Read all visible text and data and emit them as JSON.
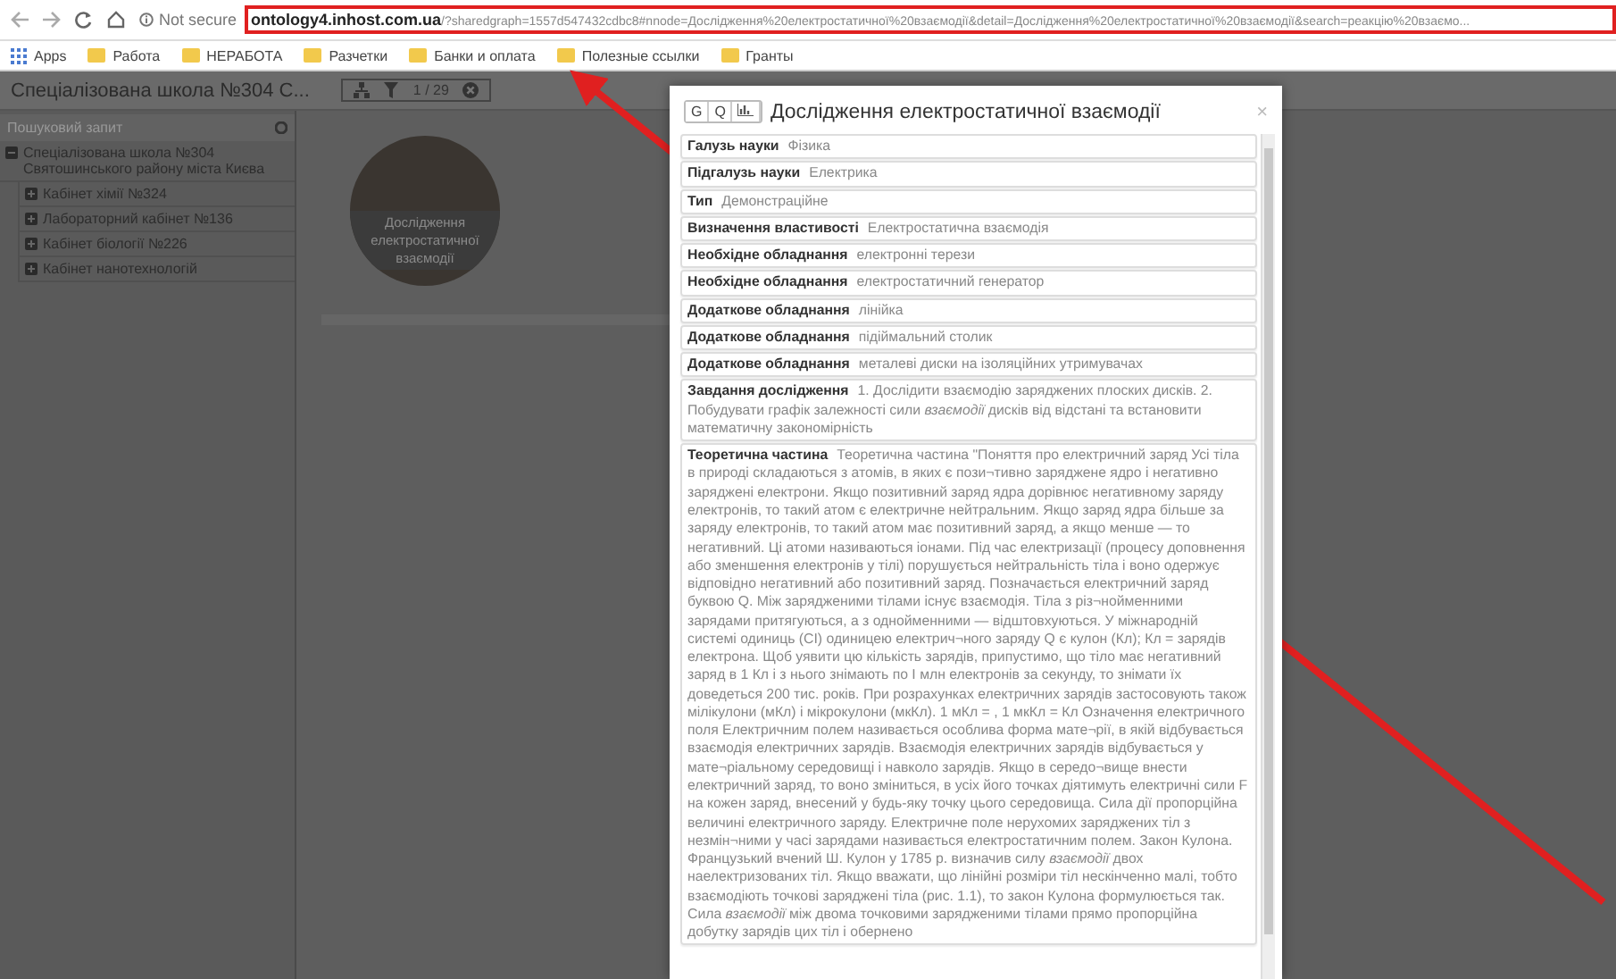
{
  "browser": {
    "security": "Not secure",
    "url_host": "ontology4.inhost.com.ua",
    "url_rest": "/?sharedgraph=1557d547432cdbc8#nnode=Дослідження%20електростатичної%20взаємодії&detail=Дослідження%20електростатичної%20взаємодії&search=реакцію%20взаємо...",
    "bookmarks": [
      {
        "label": "Apps",
        "kind": "apps"
      },
      {
        "label": "Работа",
        "kind": "folder"
      },
      {
        "label": "НЕРАБОТА",
        "kind": "folder"
      },
      {
        "label": "Разчетки",
        "kind": "folder"
      },
      {
        "label": "Банки и оплата",
        "kind": "folder"
      },
      {
        "label": "Полезные ссылки",
        "kind": "folder"
      },
      {
        "label": "Гранты",
        "kind": "folder"
      }
    ]
  },
  "app": {
    "title": "Спеціалізована школа №304 С...",
    "counter": "1 / 29",
    "search": {
      "placeholder": "Пошуковий запит"
    },
    "tree": [
      {
        "label": "Спеціалізована школа №304 Святошинського району міста Києва",
        "expanded": true,
        "children": [
          {
            "label": "Кабінет хімії №324",
            "expanded": false
          },
          {
            "label": "Лабораторний кабінет №136",
            "expanded": false
          },
          {
            "label": "Кабінет біології №226",
            "expanded": false
          },
          {
            "label": "Кабінет нанотехнологій",
            "expanded": false
          }
        ]
      }
    ],
    "node": {
      "label": "Дослідження електростатичної взаємодії"
    }
  },
  "dialog": {
    "buttons": [
      "G",
      "Q"
    ],
    "title": "Дослідження електростатичної взаємодії",
    "close": "×",
    "rows": [
      {
        "label": "Галузь науки",
        "value": "Фізика"
      },
      {
        "label": "Підгалузь науки",
        "value": "Електрика"
      },
      {
        "label": "Тип",
        "value": "Демонстраційне"
      },
      {
        "label": "Визначення властивості",
        "value": "Електростатична взаємодія"
      },
      {
        "label": "Необхідне обладнання",
        "value": "електронні терези"
      },
      {
        "label": "Необхідне обладнання",
        "value": "електростатичний генератор"
      },
      {
        "label": "Додаткове обладнання",
        "value": "лінійка"
      },
      {
        "label": "Додаткове обладнання",
        "value": "підіймальний столик"
      },
      {
        "label": "Додаткове обладнання",
        "value": "металеві диски на ізоляційних утримувачах"
      },
      {
        "label": "Завдання дослідження",
        "value": "1. Дослідити взаємодію заряджених плоских дисків. 2. Побудувати графік залежності сили *взаємодії* дисків від відстані та встановити математичну закономірність"
      },
      {
        "label": "Теоретична частина",
        "value": "Теоретична частина \"Поняття про електричний заряд Усі тіла в природі складаються з атомів, в яких є пози¬тивно заряджене ядро і негативно заряджені електрони. Якщо позитивний заряд ядра дорівнює негативному заряду електронів, то такий атом є електричне нейтральним. Якщо заряд ядра більше за заряду електронів, то такий атом має позитивний заряд, а якщо менше — то негативний. Ці атоми називаються іонами. Під час електризації (процесу доповнення або зменшення електронів у тілі) порушується нейтральність тіла і воно одержує відповідно негативний або позитивний заряд. Позначається електричний заряд буквою Q. Між зарядженими тілами існує взаємодія. Тіла з різ¬нойменними зарядами притягуються, а з однойменними — відштовхуються. У міжнародній системі одиниць (СІ) одиницею електрич¬ного заряду Q є кулон (Кл); Кл = зарядів електрона. Щоб уявити цю кількість зарядів, припустимо, що тіло має негативний заряд в 1 Кл і з нього знімають по І млн електронів за секунду, то знімати їх доведеться 200 тис. років. При розрахунках електричних зарядів застосовують також мілікулони (мКл) і мікрокулони (мкКл). 1 мКл = , 1 мкКл = Кл Означення електричного поля Електричним полем називається особлива форма мате¬рії, в якій відбувається взаємодія електричних зарядів. Взаємодія електричних зарядів відбувається у мате¬ріальному середовищі і навколо зарядів. Якщо в середо¬вище внести електричний заряд, то воно зміниться, в усіх його точках діятимуть електричні сили F на кожен заряд, внесений у будь-яку точку цього середовища. Сила дії пропорційна величині електричного заряду. Електричне поле нерухомих заряджених тіл з незмін¬ними у часі зарядами називається електростатичним полем. Закон Кулона. Французький вчений Ш. Кулон у 1785 р. визначив силу *взаємодії* двох наелектризованих тіл. Якщо вважати, що лінійні розміри тіл нескінченно малі, тобто взаємодіють точкові заряджені тіла (рис. 1.1), то закон Кулона формулюється так. Сила *взаємодії* між двома точковими зарядженими тілами прямо пропорційна добутку зарядів цих тіл і обернено"
      }
    ]
  }
}
